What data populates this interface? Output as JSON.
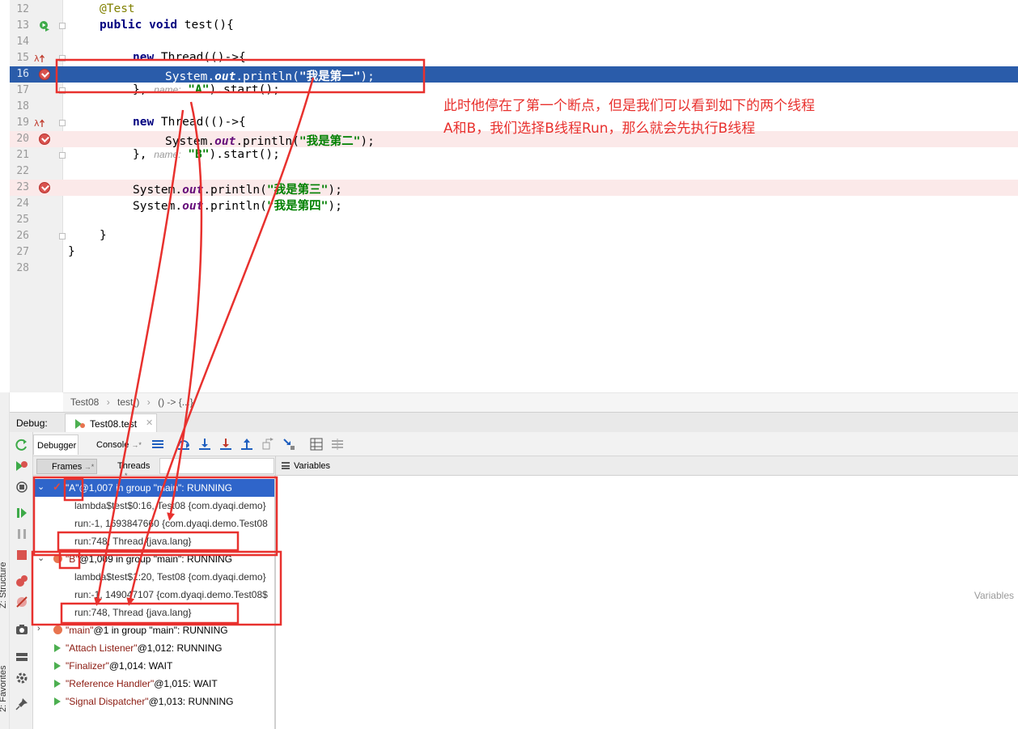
{
  "editor": {
    "lines": [
      {
        "num": "12"
      },
      {
        "num": "13"
      },
      {
        "num": "14"
      },
      {
        "num": "15"
      },
      {
        "num": "16"
      },
      {
        "num": "17"
      },
      {
        "num": "18"
      },
      {
        "num": "19"
      },
      {
        "num": "20"
      },
      {
        "num": "21"
      },
      {
        "num": "22"
      },
      {
        "num": "23"
      },
      {
        "num": "24"
      },
      {
        "num": "25"
      },
      {
        "num": "26"
      },
      {
        "num": "27"
      },
      {
        "num": "28"
      }
    ],
    "code": {
      "l12_ann": "@Test",
      "l13_kw1": "public",
      "l13_kw2": "void",
      "l13_rest": " test(){",
      "l15_kw": "new",
      "l15_rest": " Thread(()->{",
      "l16_a": "System.",
      "l16_fld": "out",
      "l16_b": ".println(",
      "l16_str": "\"我是第一\"",
      "l16_c": ");",
      "l17_a": "},",
      "l17_hint": "name:",
      "l17_str": "\"A\"",
      "l17_b": ").start();",
      "l19_kw": "new",
      "l19_rest": " Thread(()->{",
      "l20_a": "System.",
      "l20_fld": "out",
      "l20_b": ".println(",
      "l20_str": "\"我是第二\"",
      "l20_c": ");",
      "l21_a": "},",
      "l21_hint": "name:",
      "l21_str": "\"B\"",
      "l21_b": ").start();",
      "l23_a": "System.",
      "l23_fld": "out",
      "l23_b": ".println(",
      "l23_str": "\"我是第三\"",
      "l23_c": ");",
      "l24_a": "System.",
      "l24_fld": "out",
      "l24_b": ".println(",
      "l24_str": "\"我是第四\"",
      "l24_c": ");",
      "l26": "}",
      "l27": "}"
    }
  },
  "breadcrumb": [
    "Test08",
    "test()",
    "() -> {...}"
  ],
  "annotation": {
    "line1": "此时他停在了第一个断点，但是我们可以看到如下的两个线程",
    "line2": "A和B，我们选择B线程Run，那么就会先执行B线程"
  },
  "debug": {
    "label": "Debug:",
    "tab": "Test08.test",
    "toolbar": {
      "debugger": "Debugger",
      "console": "Console"
    },
    "frames_tab": "Frames",
    "threads_tab": "Threads",
    "variables_tab": "Variables",
    "variables_empty": "Variables"
  },
  "threads": [
    {
      "name": "\"A\"",
      "rest": "@1,007 in group \"main\": RUNNING"
    },
    {
      "frame": "lambda$test$0:16, Test08 {com.dyaqi.demo}"
    },
    {
      "frame": "run:-1, 1693847660 {com.dyaqi.demo.Test08"
    },
    {
      "frame": "run:748, Thread {java.lang}"
    },
    {
      "name": "\"B\"",
      "rest": "@1,009 in group \"main\": RUNNING"
    },
    {
      "frame": "lambda$test$1:20, Test08 {com.dyaqi.demo}"
    },
    {
      "frame": "run:-1, 149047107 {com.dyaqi.demo.Test08$"
    },
    {
      "frame": "run:748, Thread {java.lang}"
    },
    {
      "name": "\"main\"",
      "rest": "@1 in group \"main\": RUNNING"
    },
    {
      "name": "\"Attach Listener\"",
      "rest": "@1,012: RUNNING"
    },
    {
      "name": "\"Finalizer\"",
      "rest": "@1,014: WAIT"
    },
    {
      "name": "\"Reference Handler\"",
      "rest": "@1,015: WAIT"
    },
    {
      "name": "\"Signal Dispatcher\"",
      "rest": "@1,013: RUNNING"
    }
  ],
  "side_labels": {
    "structure": "Z: Structure",
    "favorites": "2: Favorites"
  },
  "colors": {
    "annotation_red": "#e8312e",
    "current_line": "#2a5caa",
    "breakpoint_bg": "#fbe9e9",
    "selected_row": "#2f65ca"
  }
}
